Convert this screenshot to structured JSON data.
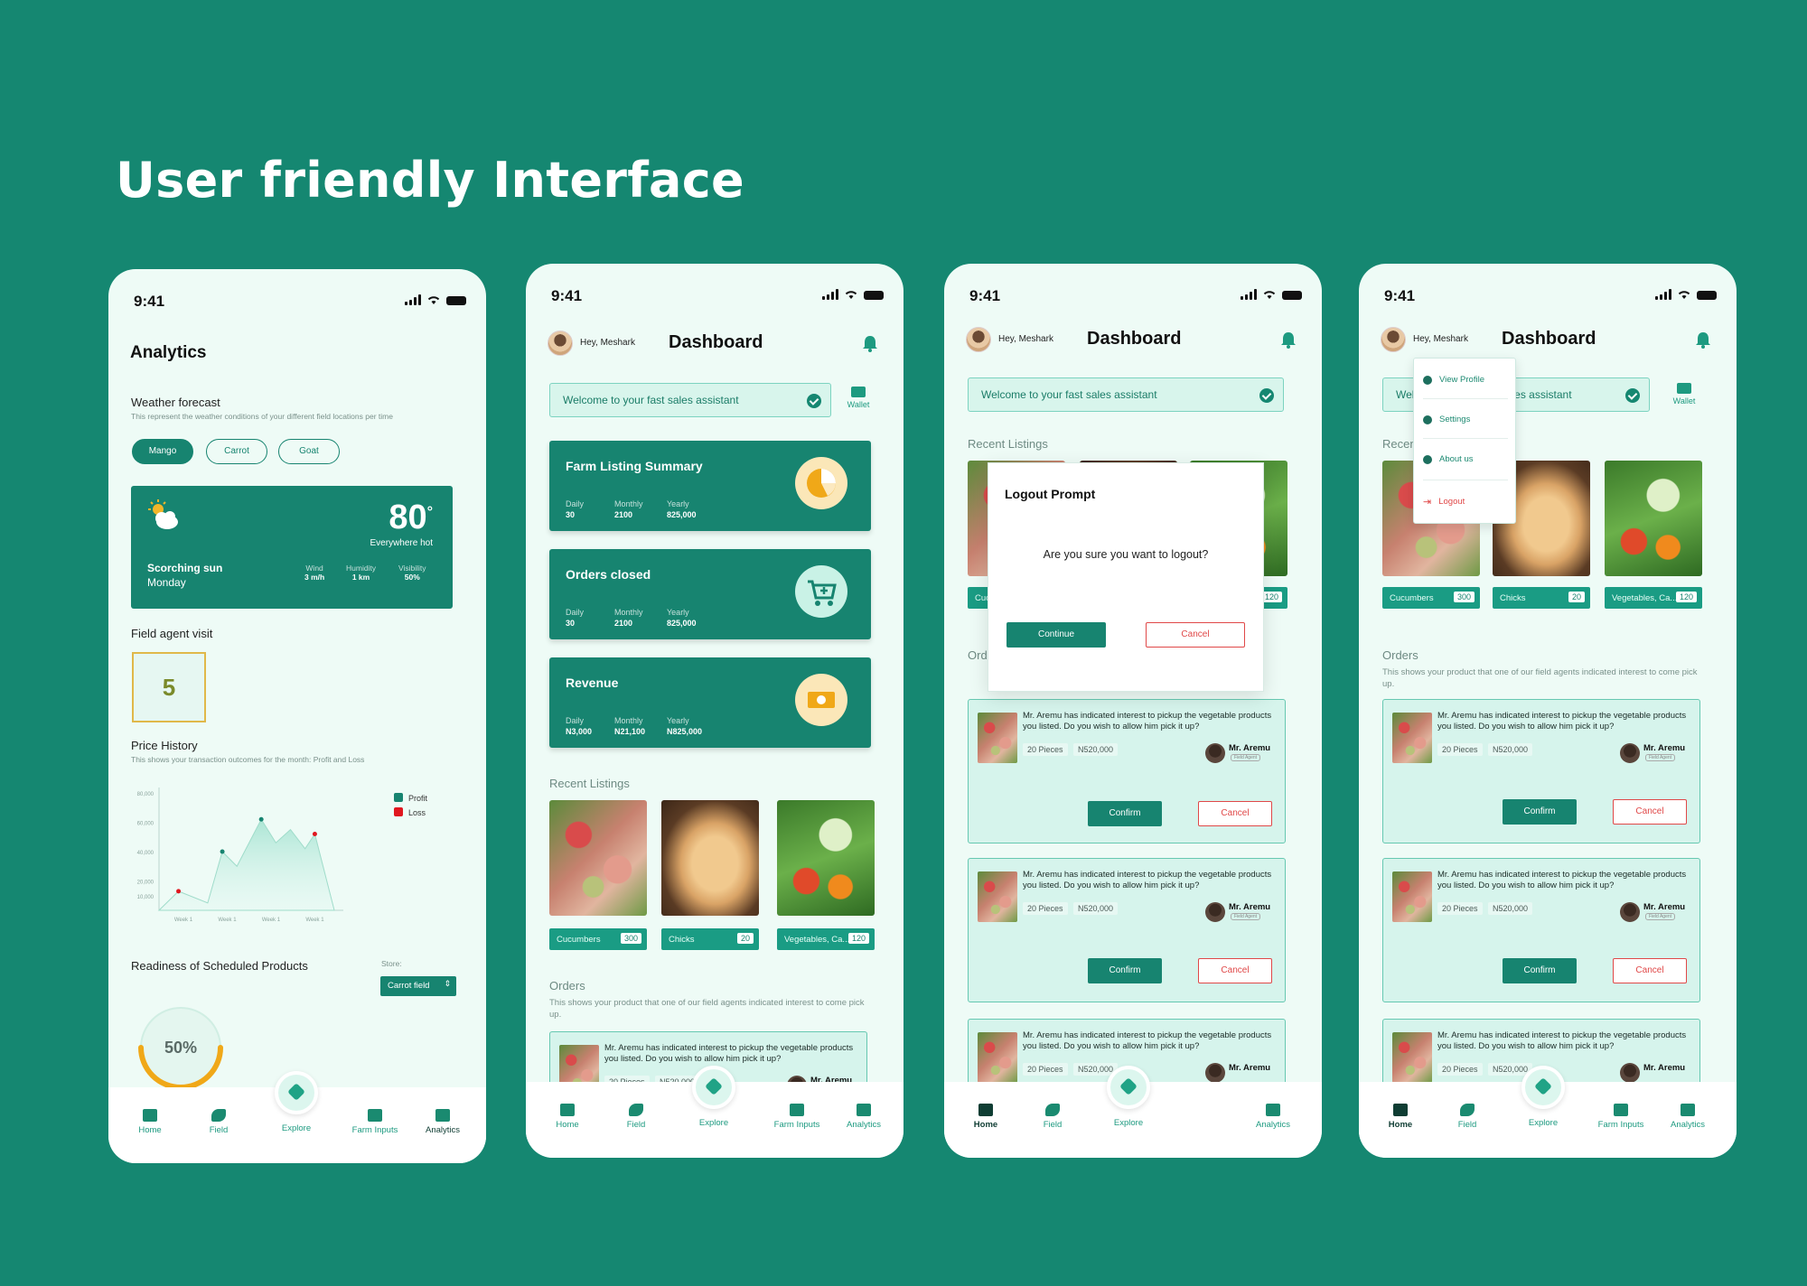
{
  "headline": "User friendly Interface",
  "status_time": "9:41",
  "analytics": {
    "title": "Analytics",
    "weather_heading": "Weather forecast",
    "weather_sub": "This represent the weather conditions of your different field locations per time",
    "chips": [
      "Mango",
      "Carrot",
      "Goat"
    ],
    "temp": "80",
    "deg": "°",
    "temp_desc": "Everywhere hot",
    "condition": "Scorching sun",
    "day": "Monday",
    "wind_label": "Wind",
    "wind": "3 m/h",
    "humidity_label": "Humidity",
    "humidity": "1 km",
    "visibility_label": "Visibility",
    "visibility": "50%",
    "agent_heading": "Field agent visit",
    "agent_count": "5",
    "price_heading": "Price History",
    "price_sub": "This shows your transaction outcomes for the month: Profit and Loss",
    "legend_profit": "Profit",
    "legend_loss": "Loss",
    "readiness_heading": "Readiness of Scheduled Products",
    "store_label": "Store:",
    "store_value": "Carrot field",
    "readiness_value": "50%",
    "readiness_fraction": 0.5
  },
  "chart_data": {
    "type": "area",
    "title": "Price History",
    "categories": [
      "Week 1",
      "Week 1",
      "Week 1",
      "Week 1"
    ],
    "y_ticks": [
      "80,000",
      "60,000",
      "40,000",
      "20,000",
      "10,000"
    ],
    "ylim": [
      0,
      80000
    ],
    "x": [
      0,
      0.4,
      1.0,
      1.3,
      1.6,
      2.1,
      2.4,
      2.7,
      3.0,
      3.2,
      3.6
    ],
    "values": [
      0,
      13000,
      5000,
      40000,
      30000,
      62000,
      46000,
      55000,
      42000,
      52000,
      0
    ],
    "markers": [
      {
        "series": "Loss",
        "x": 0.4,
        "y": 13000
      },
      {
        "series": "Profit",
        "x": 1.3,
        "y": 40000
      },
      {
        "series": "Profit",
        "x": 2.1,
        "y": 62000
      },
      {
        "series": "Loss",
        "x": 3.2,
        "y": 52000
      }
    ],
    "legend": [
      "Profit",
      "Loss"
    ],
    "colors": {
      "Profit": "#178470",
      "Loss": "#e0171f"
    }
  },
  "dashboard": {
    "greeting": "Hey, Meshark",
    "title": "Dashboard",
    "welcome": "Welcome to your fast sales assistant",
    "wallet": "Wallet",
    "cards": [
      {
        "title": "Farm Listing Summary",
        "l1": "Daily",
        "v1": "30",
        "l2": "Monthly",
        "v2": "2100",
        "l3": "Yearly",
        "v3": "825,000"
      },
      {
        "title": "Orders closed",
        "l1": "Daily",
        "v1": "30",
        "l2": "Monthly",
        "v2": "2100",
        "l3": "Yearly",
        "v3": "825,000"
      },
      {
        "title": "Revenue",
        "l1": "Daily",
        "v1": "N3,000",
        "l2": "Monthly",
        "v2": "N21,100",
        "l3": "Yearly",
        "v3": "N825,000"
      }
    ],
    "recent_heading": "Recent Listings",
    "listings": [
      {
        "name": "Cucumbers",
        "count": "300"
      },
      {
        "name": "Chicks",
        "count": "20"
      },
      {
        "name": "Vegetables, Ca...",
        "count": "120"
      }
    ],
    "orders_heading": "Orders",
    "orders_sub": "This shows your product that one of our field agents indicated interest to come pick up.",
    "order_text": "Mr. Aremu has indicated interest to pickup the vegetable products you listed. Do you wish to allow him pick it up?",
    "order_qty": "20 Pieces",
    "order_price": "N520,000",
    "order_name": "Mr. Aremu",
    "order_role": "Field Agent",
    "confirm": "Confirm",
    "cancel": "Cancel"
  },
  "logout": {
    "title": "Logout Prompt",
    "message": "Are you sure you want to logout?",
    "continue": "Continue",
    "cancel": "Cancel"
  },
  "menu": {
    "items": [
      "View Profile",
      "Settings",
      "About us",
      "Logout"
    ]
  },
  "nav": {
    "home": "Home",
    "field": "Field",
    "explore": "Explore",
    "inputs": "Farm Inputs",
    "analytics": "Analytics"
  }
}
